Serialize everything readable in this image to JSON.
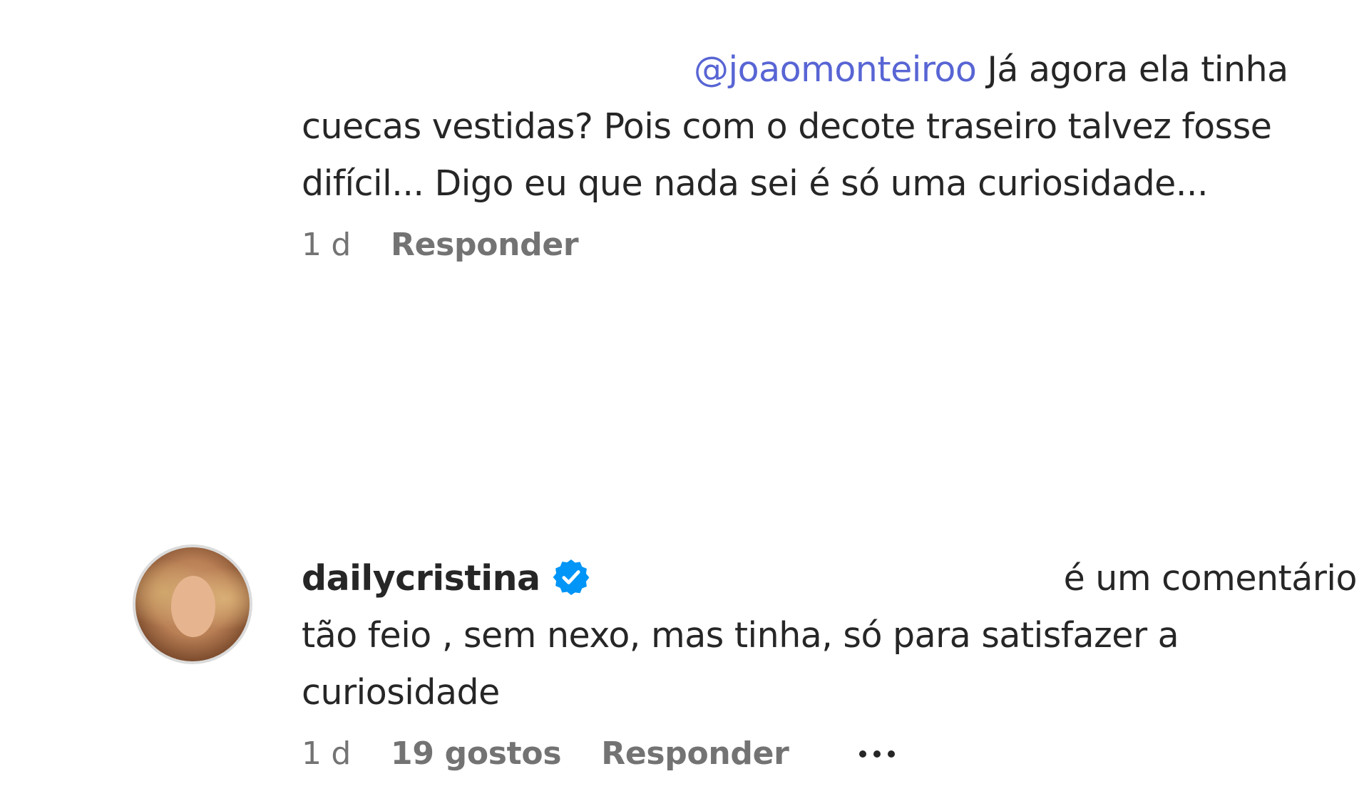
{
  "comment1": {
    "mention": "@joaomonteiroo",
    "text": " Já agora ela tinha cuecas vestidas? Pois com o decote traseiro talvez fosse difícil... Digo eu que nada sei é só uma curiosidade...",
    "time": "1 d",
    "reply_label": "Responder"
  },
  "comment2": {
    "username": "dailycristina",
    "verified_icon": "verified-badge-icon",
    "text_line1_tail": "é um comentário",
    "text_rest": "tão feio , sem nexo, mas tinha, só para satisfazer a curiosidade",
    "time": "1 d",
    "likes": "19 gostos",
    "reply_label": "Responder",
    "more_icon": "more-options-icon"
  },
  "colors": {
    "mention": "#5865d4",
    "meta_text": "#737373",
    "verified": "#0095f6"
  }
}
